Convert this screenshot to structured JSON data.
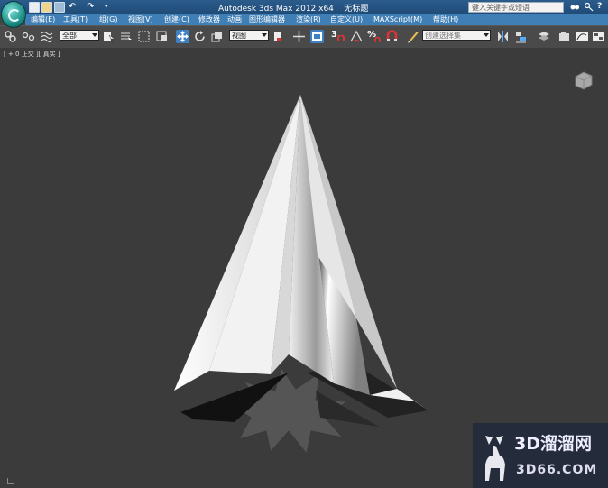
{
  "window": {
    "title": "Autodesk 3ds Max  2012 x64",
    "document": "无标题",
    "search_placeholder": "键入关键字或短语"
  },
  "menu": [
    "编辑(E)",
    "工具(T)",
    "组(G)",
    "视图(V)",
    "创建(C)",
    "修改器",
    "动画",
    "图形编辑器",
    "渲染(R)",
    "自定义(U)",
    "MAXScript(M)",
    "帮助(H)"
  ],
  "toolbar": {
    "selection_filter": "全部",
    "reference_coord": "视图",
    "snap_toggle_label": "3",
    "angle_snap_label": "%",
    "named_selection_placeholder": "创建选择集"
  },
  "viewport": {
    "label": "[ + 0 正交 ][ 真实 ]"
  },
  "watermark": {
    "text": "3D溜溜网",
    "url": "3D66.COM"
  },
  "colors": {
    "viewport_bg": "#3b3b3b",
    "title_bar": "#2b5c8c",
    "menu_bar": "#3f7fb5",
    "active_tool": "#3f7fc4"
  }
}
